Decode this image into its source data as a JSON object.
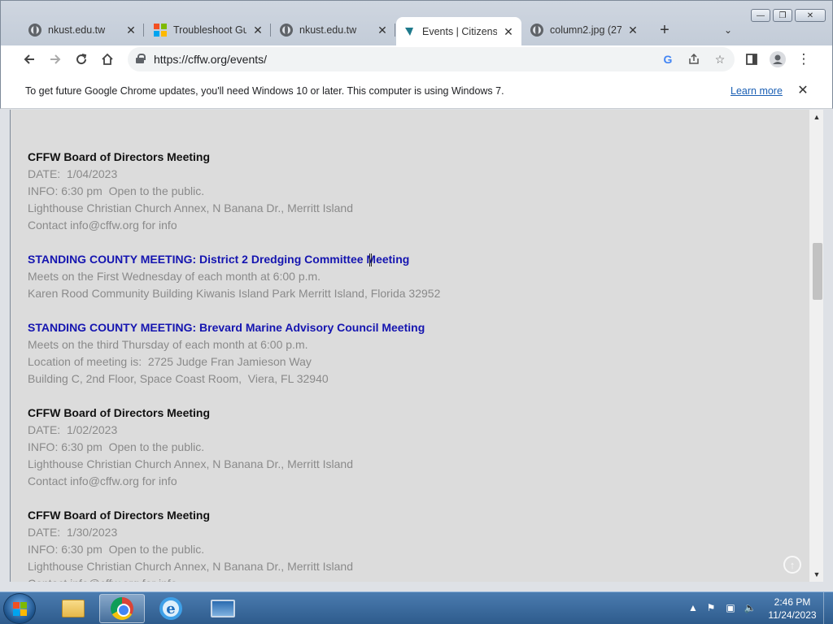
{
  "tabs": [
    {
      "title": "nkust.edu.tw",
      "icon": "globe-icon"
    },
    {
      "title": "Troubleshoot Gu",
      "icon": "microsoft-icon"
    },
    {
      "title": "nkust.edu.tw",
      "icon": "globe-icon"
    },
    {
      "title": "Events | Citizens",
      "icon": "cffw-icon"
    },
    {
      "title": "column2.jpg (27(",
      "icon": "globe-icon"
    }
  ],
  "active_tab_index": 3,
  "toolbar": {
    "url": "https://cffw.org/events/"
  },
  "infobar": {
    "message": "To get future Google Chrome updates, you'll need Windows 10 or later. This computer is using Windows 7.",
    "learn_more": "Learn more"
  },
  "events": [
    {
      "title": "CFFW Board of Directors Meeting",
      "is_link": false,
      "lines": [
        "DATE:  1/04/2023",
        "INFO: 6:30 pm  Open to the public.",
        "Lighthouse Christian Church Annex, N Banana Dr., Merritt Island",
        "Contact info@cffw.org for info"
      ]
    },
    {
      "title": "STANDING COUNTY MEETING: District 2 Dredging Committee Meeting",
      "is_link": true,
      "lines": [
        "Meets on the First Wednesday of each month at 6:00 p.m.",
        "Karen Rood Community Building Kiwanis Island Park Merritt Island, Florida 32952"
      ]
    },
    {
      "title": "STANDING COUNTY MEETING: Brevard Marine Advisory Council Meeting",
      "is_link": true,
      "lines": [
        "Meets on the third Thursday of each month at 6:00 p.m.",
        "Location of meeting is:  2725 Judge Fran Jamieson Way",
        "Building C, 2nd Floor, Space Coast Room,  Viera, FL 32940"
      ]
    },
    {
      "title": "CFFW Board of Directors Meeting",
      "is_link": false,
      "lines": [
        "DATE:  1/02/2023",
        "INFO: 6:30 pm  Open to the public.",
        "Lighthouse Christian Church Annex, N Banana Dr., Merritt Island",
        "Contact info@cffw.org for info"
      ]
    },
    {
      "title": "CFFW Board of Directors Meeting",
      "is_link": false,
      "lines": [
        "DATE:  1/30/2023",
        "INFO: 6:30 pm  Open to the public.",
        "Lighthouse Christian Church Annex, N Banana Dr., Merritt Island",
        "Contact info@cffw.org for info"
      ]
    }
  ],
  "taskbar": {
    "time": "2:46 PM",
    "date": "11/24/2023",
    "apps": [
      "explorer-icon",
      "chrome-icon",
      "internet-explorer-icon",
      "remote-desktop-icon"
    ]
  },
  "colors": {
    "link_title": "#1515b0",
    "page_bg": "#dcdcdc",
    "detail_text": "#8a8a8a",
    "learn_more": "#1a5fb4"
  }
}
